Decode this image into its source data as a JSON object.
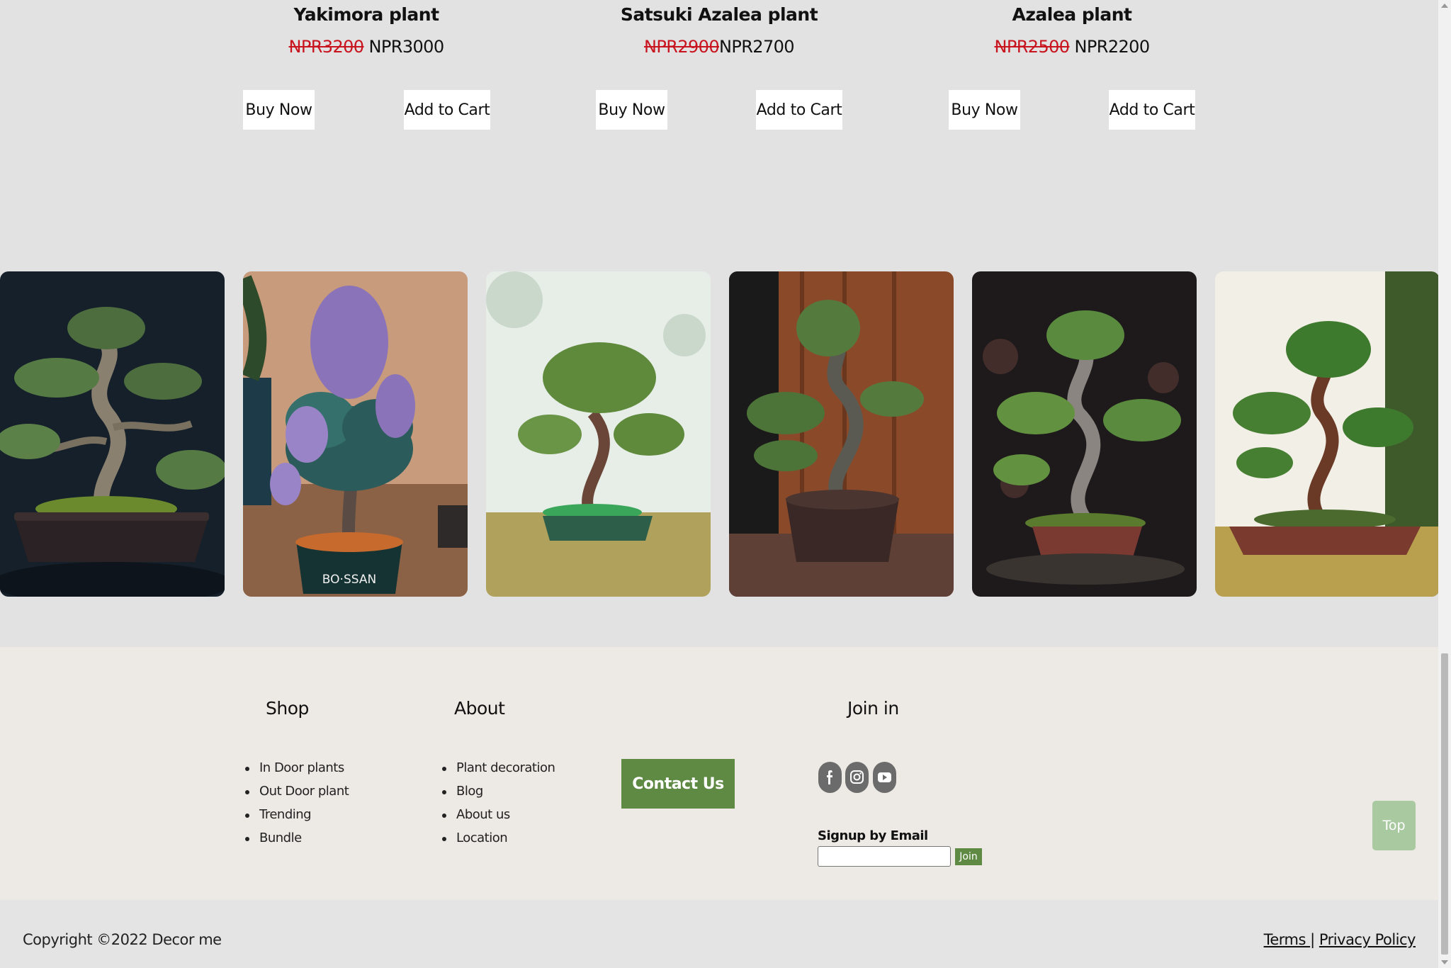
{
  "products": [
    {
      "name": "Yakimora plant",
      "old_price": "NPR3200",
      "new_price": "NPR3000",
      "buy_label": "Buy Now",
      "cart_label": "Add to Cart"
    },
    {
      "name": "Satsuki Azalea plant",
      "old_price": "NPR2900",
      "new_price": "NPR2700",
      "buy_label": "Buy Now",
      "cart_label": "Add to Cart"
    },
    {
      "name": "Azalea plant",
      "old_price": "NPR2500",
      "new_price": "NPR2200",
      "buy_label": "Buy Now",
      "cart_label": "Add to Cart"
    }
  ],
  "gallery": {
    "pot_text": "BO·SSAN",
    "images": [
      "dark-background-twisted-bonsai",
      "purple-flowering-bonsai",
      "light-background-bonsai",
      "wooden-wall-bonsai",
      "dark-bokeh-bonsai",
      "sunlit-bonsai"
    ]
  },
  "footer": {
    "shop": {
      "title": "Shop",
      "links": [
        "In Door plants",
        "Out Door plant",
        "Trending",
        "Bundle"
      ]
    },
    "about": {
      "title": "About",
      "links": [
        "Plant decoration",
        "Blog",
        "About us",
        "Location"
      ]
    },
    "contact_label": "Contact Us",
    "join": {
      "title": "Join in",
      "social": [
        "facebook-icon",
        "instagram-icon",
        "youtube-icon"
      ],
      "signup_label": "Signup by Email",
      "email_value": "",
      "join_label": "Join"
    },
    "top_label": "Top"
  },
  "bottom": {
    "copyright": "Copyright ©2022 Decor me",
    "terms": "Terms ",
    "separator": "|",
    "privacy": "Privacy Policy"
  },
  "colors": {
    "accent": "#5e8a44",
    "sale_red": "#c8141e",
    "top_button": "#a9c9a0",
    "footer_bg": "#ede9e4",
    "page_bg": "#e2e2e2"
  }
}
